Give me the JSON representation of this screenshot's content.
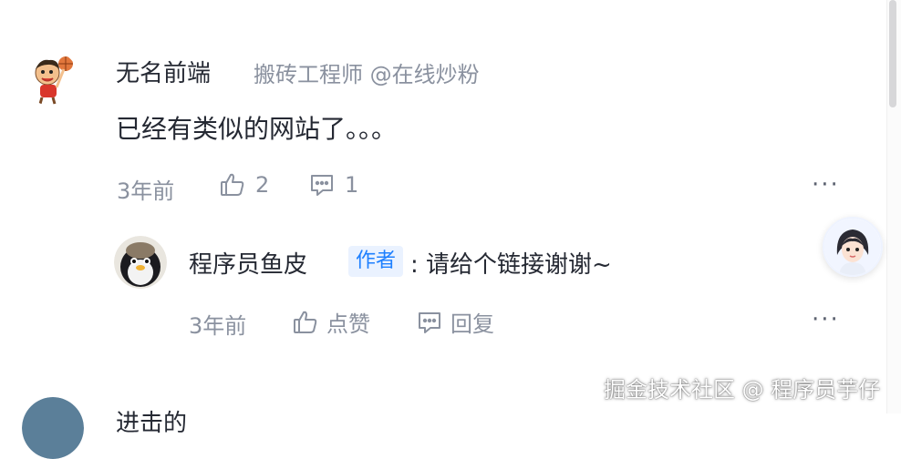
{
  "comments": [
    {
      "username": "无名前端",
      "user_title": "搬砖工程师 @在线炒粉",
      "content": "已经有类似的网站了。。。",
      "time": "3年前",
      "like_count": "2",
      "reply_count": "1",
      "replies": [
        {
          "username": "程序员鱼皮",
          "badge": "作者",
          "content": ": 请给个链接谢谢~",
          "time": "3年前",
          "like_label": "点赞",
          "reply_label": "回复"
        }
      ]
    },
    {
      "username": "进击的"
    }
  ],
  "more_label": "···",
  "watermark": "掘金技术社区 @ 程序员芋仔",
  "colors": {
    "accent": "#1e80ff",
    "badge_bg": "#eaf2ff",
    "meta_text": "#8a919f",
    "main_text": "#252933"
  },
  "icons": {
    "like": "thumbs-up-icon",
    "reply": "comment-icon",
    "more": "more-icon"
  }
}
